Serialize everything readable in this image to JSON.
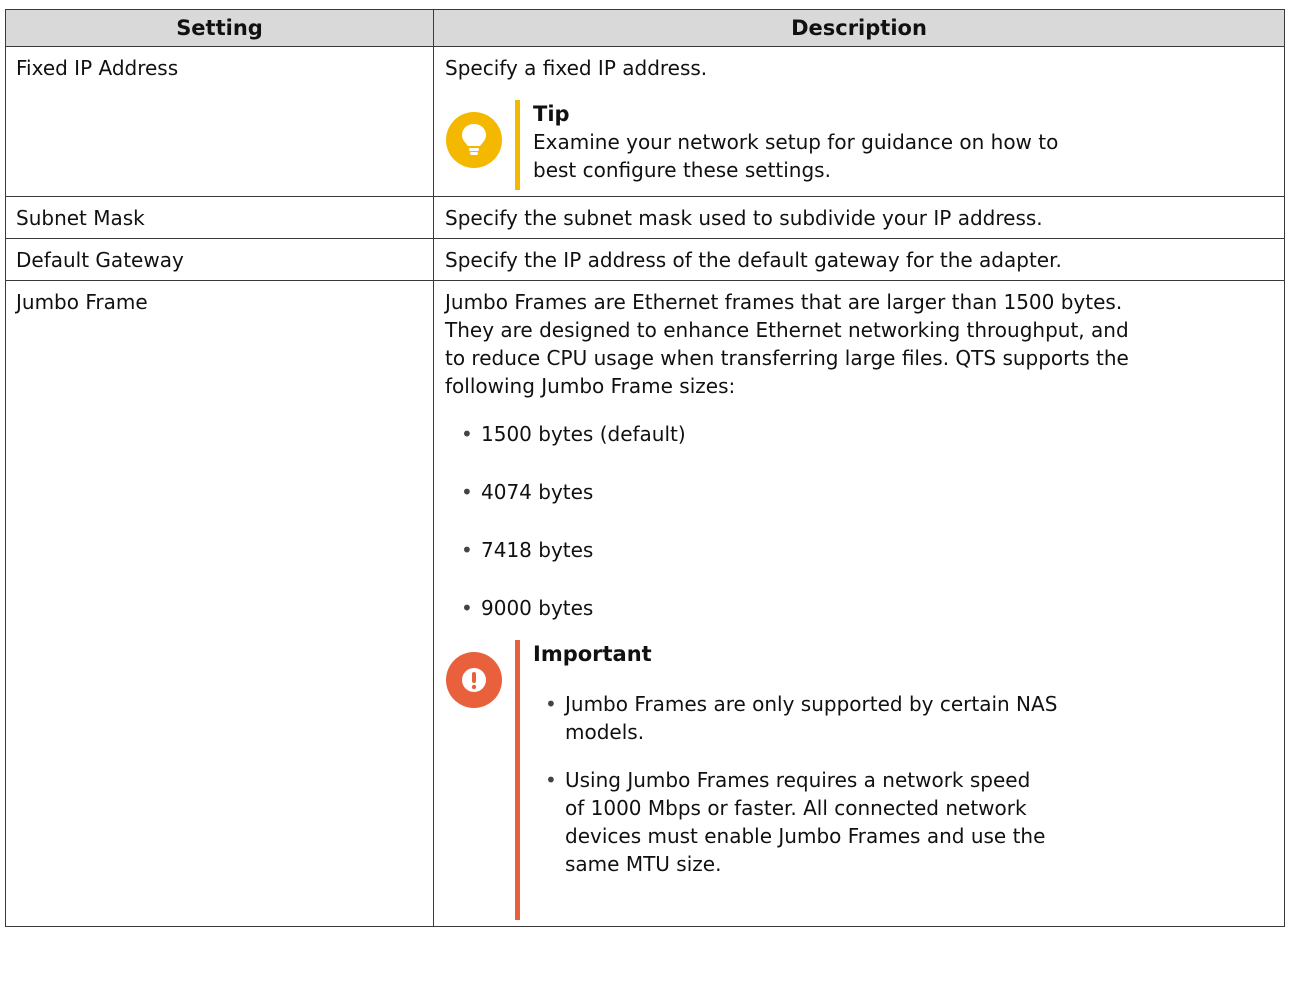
{
  "table": {
    "headers": [
      "Setting",
      "Description"
    ],
    "rows": [
      {
        "setting": "Fixed IP Address",
        "description": "Specify a fixed IP address.",
        "tip": {
          "title": "Tip",
          "line1": "Examine your network setup for guidance on how to",
          "line2": "best configure these settings."
        }
      },
      {
        "setting": "Subnet Mask",
        "description": "Specify the subnet mask used to subdivide your IP address."
      },
      {
        "setting": "Default Gateway",
        "description": "Specify the IP address of the default gateway for the adapter."
      },
      {
        "setting": "Jumbo Frame",
        "description_lines": [
          "Jumbo Frames are Ethernet frames that are larger than 1500 bytes.",
          "They are designed to enhance Ethernet networking throughput, and",
          "to reduce CPU usage when transferring large files. QTS supports the",
          "following Jumbo Frame sizes:"
        ],
        "sizes": [
          "1500 bytes (default)",
          "4074 bytes",
          "7418 bytes",
          "9000 bytes"
        ],
        "important": {
          "title": "Important",
          "items": [
            [
              "Jumbo Frames are only supported by certain NAS",
              "models."
            ],
            [
              "Using Jumbo Frames requires a network speed",
              "of 1000 Mbps or faster. All connected network",
              "devices must enable Jumbo Frames and use the",
              "same MTU size."
            ]
          ]
        }
      }
    ]
  },
  "colors": {
    "tip": "#f5b800",
    "important": "#e8603c",
    "header_bg": "#d9d9d9"
  },
  "icons": {
    "tip": "lightbulb-icon",
    "important": "exclamation-icon",
    "bullet": "•"
  }
}
